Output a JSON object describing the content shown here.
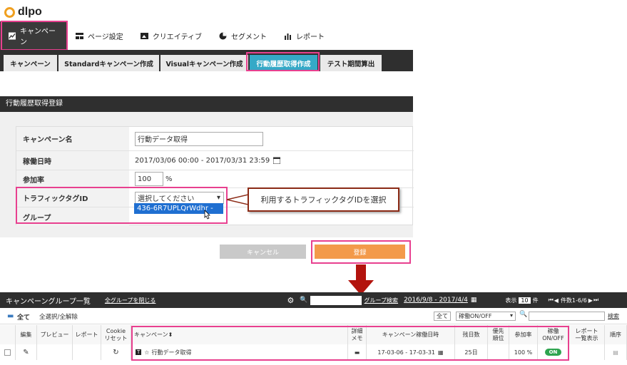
{
  "logo": {
    "text": "dlpo"
  },
  "main_nav": [
    {
      "label": "キャンペーン",
      "icon": "chart-icon"
    },
    {
      "label": "ページ設定",
      "icon": "layout-icon"
    },
    {
      "label": "クリエイティブ",
      "icon": "image-icon"
    },
    {
      "label": "セグメント",
      "icon": "pie-icon"
    },
    {
      "label": "レポート",
      "icon": "bar-icon"
    }
  ],
  "sub_tabs": [
    "キャンペーン",
    "Standardキャンペーン作成",
    "Visualキャンペーン作成",
    "行動履歴取得作成",
    "テスト期間算出"
  ],
  "panel": {
    "title": "行動履歴取得登録",
    "fields": {
      "campaign_name_label": "キャンペーン名",
      "campaign_name_value": "行動データ取得",
      "period_label": "稼働日時",
      "period_value": "2017/03/06 00:00 - 2017/03/31 23:59",
      "rate_label": "参加率",
      "rate_value": "100",
      "rate_unit": "%",
      "tag_label": "トラフィックタグID",
      "tag_select": "選択してください",
      "tag_option": "436-6R7UPLQrWdhr -",
      "group_label": "グループ"
    },
    "callout": "利用するトラフィックタグIDを選択",
    "cancel": "キャンセル",
    "register": "登録"
  },
  "list": {
    "title": "キャンペーングループ一覧",
    "collapse": "全グループを閉じる",
    "group_search": "グループ検索",
    "date_range": "2016/9/8 - 2017/4/4",
    "display_label": "表示",
    "per_page": "10",
    "per_unit": "件",
    "count": "件数1-6/6",
    "all": "全て",
    "select_all": "全選択/全解除",
    "filter_all": "全て",
    "filter_onoff": "稼働ON/OFF",
    "search": "検索",
    "headers": [
      "編集",
      "プレビュー",
      "レポート",
      "Cookie\nリセット",
      "キャンペーン",
      "詳細\nメモ",
      "キャンペーン稼働日時",
      "残日数",
      "優先\n順位",
      "参加率",
      "稼働\nON/OFF",
      "レポート\n一覧表示",
      "順序"
    ],
    "row": {
      "campaign": "行動データ取得",
      "period": "17-03-06 - 17-03-31",
      "remaining": "25日",
      "rate": "100 %",
      "status": "ON",
      "type": "T"
    }
  }
}
